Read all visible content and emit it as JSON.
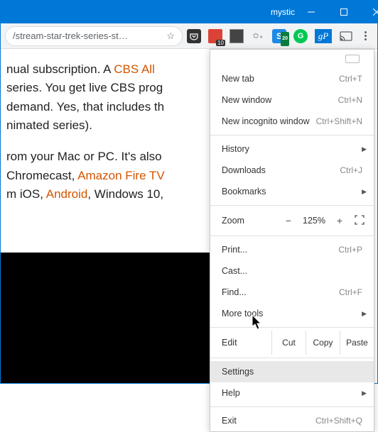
{
  "window": {
    "title": "mystic"
  },
  "url": "/stream-star-trek-series-st…",
  "content": {
    "p1_a": "nual subscription. A ",
    "p1_link": "CBS All",
    "p1_b": " series. You get live CBS prog",
    "p1_c": "demand. Yes, that includes th",
    "p1_d": "nimated series).",
    "p2_a": "rom your Mac or PC. It's also",
    "p2_b": " Chromecast, ",
    "p2_link1": "Amazon Fire TV",
    "p2_c": "m iOS, ",
    "p2_link2": "Android",
    "p2_d": ", Windows 10,"
  },
  "ext": {
    "red_badge": "10",
    "s_label": "S",
    "s_badge": "20",
    "g_label": "G",
    "gp_label": "gP"
  },
  "menu": {
    "new_tab": "New tab",
    "new_tab_sc": "Ctrl+T",
    "new_window": "New window",
    "new_window_sc": "Ctrl+N",
    "incognito": "New incognito window",
    "incognito_sc": "Ctrl+Shift+N",
    "history": "History",
    "downloads": "Downloads",
    "downloads_sc": "Ctrl+J",
    "bookmarks": "Bookmarks",
    "zoom": "Zoom",
    "zoom_val": "125%",
    "print": "Print...",
    "print_sc": "Ctrl+P",
    "cast": "Cast...",
    "find": "Find...",
    "find_sc": "Ctrl+F",
    "more_tools": "More tools",
    "edit": "Edit",
    "cut": "Cut",
    "copy": "Copy",
    "paste": "Paste",
    "settings": "Settings",
    "help": "Help",
    "exit": "Exit",
    "exit_sc": "Ctrl+Shift+Q"
  }
}
